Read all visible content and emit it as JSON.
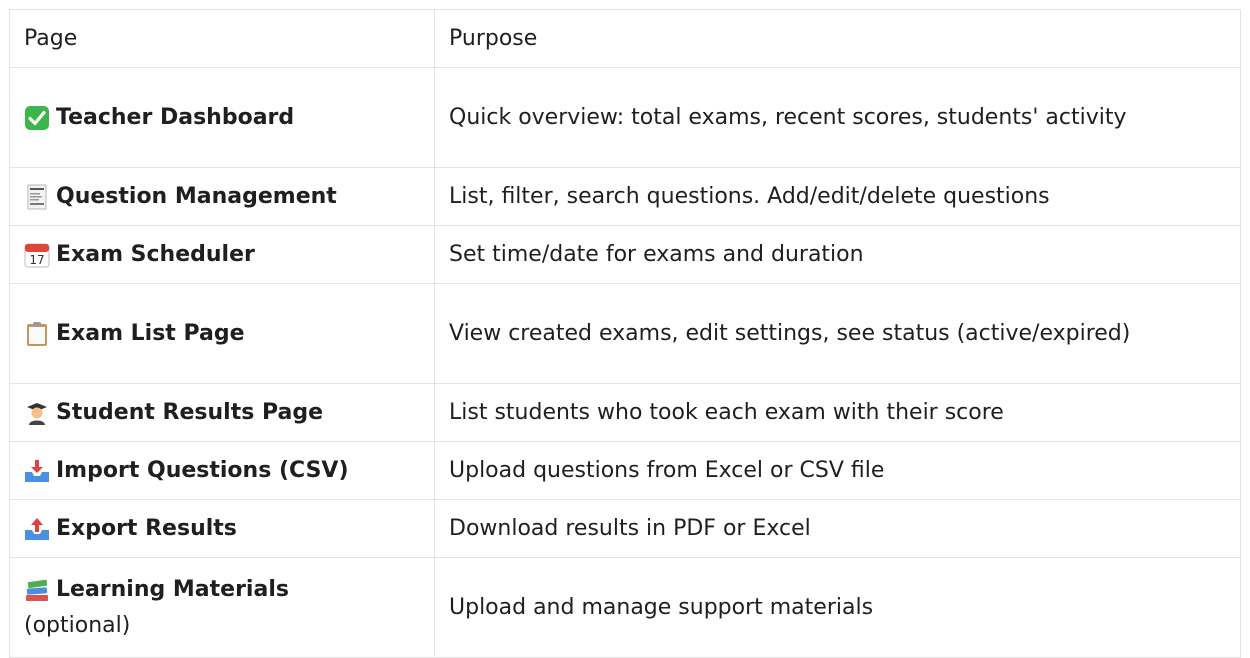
{
  "table": {
    "headers": {
      "page": "Page",
      "purpose": "Purpose"
    },
    "rows": [
      {
        "icon": "check-mark-icon",
        "page": "Teacher Dashboard",
        "purpose": "Quick overview: total exams, recent scores, students' activity",
        "optional": ""
      },
      {
        "icon": "receipt-icon",
        "page": "Question Management",
        "purpose": "List, filter, search questions. Add/edit/delete questions",
        "optional": ""
      },
      {
        "icon": "calendar-icon",
        "page": "Exam Scheduler",
        "purpose": "Set time/date for exams and duration",
        "optional": ""
      },
      {
        "icon": "clipboard-icon",
        "page": "Exam List Page",
        "purpose": "View created exams, edit settings, see status (active/expired)",
        "optional": ""
      },
      {
        "icon": "student-icon",
        "page": "Student Results Page",
        "purpose": "List students who took each exam with their score",
        "optional": ""
      },
      {
        "icon": "inbox-tray-icon",
        "page": "Import Questions (CSV)",
        "purpose": "Upload questions from Excel or CSV file",
        "optional": ""
      },
      {
        "icon": "outbox-tray-icon",
        "page": "Export Results",
        "purpose": "Download results in PDF or Excel",
        "optional": ""
      },
      {
        "icon": "books-icon",
        "page": "Learning Materials",
        "purpose": "Upload and manage support materials",
        "optional": "(optional)"
      }
    ]
  },
  "colors": {
    "border": "#e3e3e3",
    "text": "#1f1f1f",
    "check": "#3cb64a"
  }
}
